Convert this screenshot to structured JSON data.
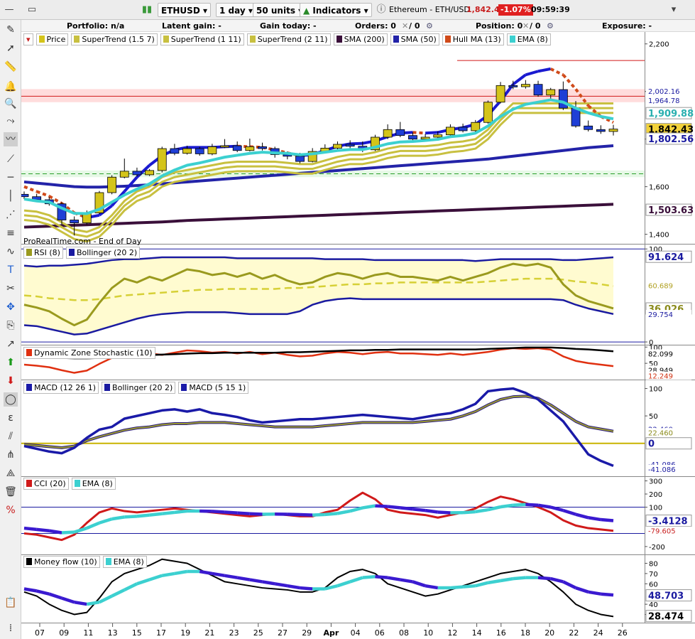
{
  "toolbar": {
    "symbol": "ETHUSD",
    "timeframe": "1 day",
    "units": "50 units",
    "indicators": "Indicators",
    "instrument": "Ethereum - ETH/USD",
    "price": "1,842.43",
    "change": "-1.07%",
    "time": "09:59:39"
  },
  "infobar": {
    "portfolio": "Portfolio: n/a",
    "latent": "Latent gain: -",
    "today": "Gain today: -",
    "orders": "Orders: 0",
    "orders_b": "/ 0",
    "position": "Position: 0",
    "position_b": "/ 0",
    "exposure": "Exposure: -"
  },
  "source_label": "ProRealTime.com - End of Day",
  "colors": {
    "up": "#d4c41a",
    "down": "#1f3fd6",
    "supertrend": "#c8c040",
    "sma200": "#3a0f3a",
    "sma50": "#2323a8",
    "hull_up": "#1a1ad0",
    "hull_dn": "#d04a1a",
    "ema": "#3cd0d0",
    "rsi": "#9a9a1e",
    "boll": "#1a1aa0",
    "cci": "#d01a1a",
    "mfi": "#000000"
  },
  "panels": [
    {
      "id": "price",
      "legend": [
        "Price",
        "SuperTrend (1.5 7)",
        "SuperTrend (1 11)",
        "SuperTrend (2 11)",
        "SMA (200)",
        "SMA (50)",
        "Hull MA (13)",
        "EMA (8)"
      ],
      "ticks": [
        "2,200",
        "2,000",
        "1,800",
        "1,600",
        "1,400"
      ],
      "tags": [
        "2,002.16",
        "1,964.78",
        "1,909.88",
        "1,842.43",
        "1,802.56",
        "1,503.63"
      ]
    },
    {
      "id": "rsi",
      "legend": [
        "RSI (8)",
        "Bollinger (20 2)"
      ],
      "ticks": [
        "100",
        "0"
      ],
      "tags": [
        "91.624",
        "60.689",
        "36.026",
        "29.754"
      ]
    },
    {
      "id": "dzs",
      "legend": [
        "Dynamic Zone Stochastic (10)"
      ],
      "ticks": [
        "100",
        "50"
      ],
      "tags": [
        "82.099",
        "28.949",
        "12.249"
      ]
    },
    {
      "id": "macd",
      "legend": [
        "MACD (12 26 1)",
        "Bollinger (20 2)",
        "MACD (5 15 1)"
      ],
      "ticks": [
        "100",
        "50"
      ],
      "tags": [
        "22.460",
        "22.460",
        "0",
        "-41.086",
        "-41.086"
      ]
    },
    {
      "id": "cci",
      "legend": [
        "CCI (20)",
        "EMA (8)"
      ],
      "ticks": [
        "300",
        "200",
        "100",
        "-200"
      ],
      "tags": [
        "-3.4128",
        "-79.605"
      ]
    },
    {
      "id": "mfi",
      "legend": [
        "Money flow (10)",
        "EMA (8)"
      ],
      "ticks": [
        "80",
        "70",
        "60",
        "40",
        "30"
      ],
      "tags": [
        "48.703",
        "28.474"
      ]
    }
  ],
  "x_axis": [
    "07",
    "09",
    "11",
    "13",
    "15",
    "17",
    "19",
    "21",
    "23",
    "25",
    "27",
    "29",
    "Apr",
    "04",
    "06",
    "08",
    "10",
    "12",
    "14",
    "16",
    "18",
    "20",
    "22",
    "24",
    "26"
  ],
  "chart_data": {
    "type": "candlestick",
    "candles": [
      [
        1568,
        1558,
        1580,
        1548
      ],
      [
        1558,
        1545,
        1570,
        1538
      ],
      [
        1545,
        1528,
        1556,
        1520
      ],
      [
        1528,
        1460,
        1535,
        1440
      ],
      [
        1460,
        1448,
        1475,
        1395
      ],
      [
        1448,
        1490,
        1500,
        1440
      ],
      [
        1490,
        1575,
        1582,
        1485
      ],
      [
        1575,
        1640,
        1648,
        1568
      ],
      [
        1640,
        1665,
        1718,
        1635
      ],
      [
        1665,
        1650,
        1680,
        1642
      ],
      [
        1650,
        1668,
        1674,
        1645
      ],
      [
        1668,
        1760,
        1768,
        1660
      ],
      [
        1760,
        1740,
        1780,
        1732
      ],
      [
        1740,
        1760,
        1772,
        1735
      ],
      [
        1760,
        1738,
        1768,
        1730
      ],
      [
        1738,
        1768,
        1780,
        1732
      ],
      [
        1768,
        1772,
        1800,
        1762
      ],
      [
        1772,
        1752,
        1790,
        1745
      ],
      [
        1752,
        1768,
        1802,
        1748
      ],
      [
        1768,
        1760,
        1785,
        1752
      ],
      [
        1760,
        1735,
        1768,
        1722
      ],
      [
        1735,
        1728,
        1748,
        1715
      ],
      [
        1728,
        1706,
        1742,
        1698
      ],
      [
        1706,
        1748,
        1762,
        1702
      ],
      [
        1748,
        1762,
        1778,
        1740
      ],
      [
        1762,
        1778,
        1790,
        1755
      ],
      [
        1778,
        1770,
        1795,
        1762
      ],
      [
        1770,
        1755,
        1790,
        1745
      ],
      [
        1755,
        1808,
        1818,
        1750
      ],
      [
        1808,
        1840,
        1862,
        1800
      ],
      [
        1840,
        1815,
        1872,
        1808
      ],
      [
        1815,
        1800,
        1828,
        1792
      ],
      [
        1800,
        1808,
        1822,
        1795
      ],
      [
        1808,
        1818,
        1832,
        1800
      ],
      [
        1818,
        1850,
        1862,
        1810
      ],
      [
        1850,
        1835,
        1865,
        1828
      ],
      [
        1835,
        1870,
        1880,
        1830
      ],
      [
        1870,
        1955,
        1962,
        1865
      ],
      [
        1955,
        2025,
        2040,
        1950
      ],
      [
        2025,
        2020,
        2045,
        2010
      ],
      [
        2020,
        2030,
        2048,
        2012
      ],
      [
        2030,
        1985,
        2045,
        1978
      ],
      [
        1985,
        2008,
        2015,
        1960
      ],
      [
        2008,
        1930,
        2042,
        1922
      ],
      [
        1930,
        1855,
        1960,
        1848
      ],
      [
        1855,
        1840,
        1878,
        1832
      ],
      [
        1840,
        1832,
        1858,
        1822
      ],
      [
        1832,
        1842,
        1860,
        1815
      ]
    ],
    "ema8": [
      1548,
      1540,
      1535,
      1510,
      1488,
      1487,
      1505,
      1535,
      1565,
      1590,
      1612,
      1645,
      1670,
      1690,
      1700,
      1712,
      1724,
      1732,
      1740,
      1745,
      1742,
      1740,
      1734,
      1738,
      1745,
      1752,
      1756,
      1756,
      1766,
      1780,
      1788,
      1790,
      1794,
      1799,
      1810,
      1815,
      1825,
      1855,
      1895,
      1925,
      1946,
      1955,
      1965,
      1955,
      1930,
      1910,
      1895,
      1885
    ],
    "sma50": [
      1620,
      1615,
      1610,
      1605,
      1600,
      1598,
      1598,
      1600,
      1602,
      1605,
      1608,
      1612,
      1616,
      1620,
      1624,
      1628,
      1632,
      1636,
      1640,
      1644,
      1648,
      1652,
      1656,
      1660,
      1664,
      1668,
      1672,
      1676,
      1680,
      1684,
      1688,
      1692,
      1696,
      1700,
      1704,
      1708,
      1712,
      1716,
      1722,
      1728,
      1734,
      1740,
      1746,
      1752,
      1758,
      1764,
      1768,
      1772
    ],
    "sma200": [
      1430,
      1432,
      1434,
      1436,
      1438,
      1440,
      1442,
      1444,
      1446,
      1448,
      1450,
      1452,
      1455,
      1458,
      1460,
      1462,
      1464,
      1466,
      1468,
      1470,
      1472,
      1474,
      1476,
      1478,
      1480,
      1482,
      1484,
      1486,
      1488,
      1490,
      1492,
      1494,
      1496,
      1498,
      1500,
      1502,
      1504,
      1506,
      1508,
      1510,
      1512,
      1514,
      1516,
      1518,
      1520,
      1522,
      1524,
      1526
    ],
    "hull": [
      1600,
      1580,
      1560,
      1530,
      1490,
      1470,
      1480,
      1520,
      1580,
      1640,
      1690,
      1730,
      1755,
      1765,
      1765,
      1765,
      1768,
      1770,
      1768,
      1765,
      1755,
      1742,
      1730,
      1735,
      1752,
      1770,
      1780,
      1782,
      1792,
      1810,
      1825,
      1828,
      1825,
      1828,
      1840,
      1848,
      1862,
      1900,
      1960,
      2030,
      2070,
      2085,
      2095,
      2070,
      2010,
      1940,
      1895,
      1870
    ],
    "st1": [
      1500,
      1495,
      1480,
      1450,
      1420,
      1410,
      1430,
      1480,
      1540,
      1580,
      1600,
      1640,
      1660,
      1670,
      1680,
      1690,
      1700,
      1705,
      1705,
      1705,
      1705,
      1700,
      1695,
      1695,
      1710,
      1725,
      1735,
      1735,
      1745,
      1760,
      1770,
      1770,
      1770,
      1775,
      1785,
      1790,
      1800,
      1840,
      1900,
      1950,
      1950,
      1950,
      1950,
      1950,
      1950,
      1950,
      1950,
      1950
    ],
    "st2": [
      1480,
      1475,
      1460,
      1430,
      1400,
      1390,
      1410,
      1460,
      1520,
      1560,
      1580,
      1620,
      1640,
      1650,
      1660,
      1670,
      1680,
      1685,
      1685,
      1685,
      1685,
      1680,
      1675,
      1675,
      1690,
      1705,
      1715,
      1715,
      1725,
      1740,
      1750,
      1750,
      1750,
      1755,
      1765,
      1770,
      1780,
      1820,
      1880,
      1930,
      1930,
      1930,
      1930,
      1930,
      1930,
      1930,
      1930,
      1930
    ],
    "st3": [
      1460,
      1455,
      1440,
      1410,
      1380,
      1370,
      1390,
      1440,
      1500,
      1540,
      1560,
      1600,
      1620,
      1630,
      1640,
      1650,
      1660,
      1665,
      1665,
      1665,
      1665,
      1660,
      1655,
      1655,
      1670,
      1685,
      1695,
      1695,
      1705,
      1720,
      1730,
      1730,
      1730,
      1735,
      1745,
      1750,
      1760,
      1800,
      1860,
      1910,
      1910,
      1910,
      1910,
      1910,
      1910,
      1910,
      1910,
      1910
    ],
    "rsi": [
      40,
      37,
      33,
      25,
      18,
      24,
      42,
      58,
      68,
      64,
      70,
      66,
      72,
      78,
      76,
      72,
      74,
      70,
      74,
      68,
      72,
      66,
      62,
      64,
      70,
      74,
      72,
      68,
      72,
      74,
      70,
      70,
      68,
      66,
      70,
      66,
      70,
      74,
      80,
      84,
      82,
      84,
      80,
      62,
      50,
      44,
      40,
      36
    ],
    "boll_up": [
      82,
      81,
      82,
      82,
      83,
      84,
      86,
      88,
      89,
      89,
      90,
      91,
      91,
      91,
      91,
      91,
      91,
      90,
      90,
      90,
      90,
      90,
      90,
      90,
      89,
      89,
      89,
      89,
      88,
      88,
      88,
      88,
      88,
      88,
      88,
      88,
      87,
      88,
      89,
      89,
      89,
      89,
      89,
      88,
      88,
      89,
      90,
      91
    ],
    "boll_mid": [
      50,
      49,
      47,
      46,
      45,
      45,
      46,
      48,
      50,
      51,
      52,
      53,
      54,
      55,
      56,
      56,
      57,
      57,
      57,
      57,
      57,
      58,
      58,
      59,
      60,
      61,
      62,
      62,
      63,
      63,
      64,
      64,
      64,
      64,
      64,
      64,
      64,
      65,
      66,
      67,
      68,
      68,
      68,
      67,
      65,
      64,
      62,
      60
    ],
    "boll_dn": [
      18,
      17,
      14,
      11,
      8,
      9,
      13,
      17,
      21,
      25,
      28,
      30,
      31,
      32,
      32,
      32,
      32,
      31,
      30,
      30,
      30,
      30,
      33,
      40,
      44,
      46,
      47,
      46,
      46,
      46,
      46,
      46,
      46,
      46,
      46,
      46,
      46,
      46,
      46,
      46,
      46,
      46,
      46,
      45,
      40,
      36,
      33,
      30
    ],
    "macd_fast": [
      -5,
      -10,
      -15,
      -18,
      -8,
      10,
      25,
      30,
      45,
      50,
      55,
      60,
      62,
      58,
      62,
      55,
      52,
      48,
      42,
      38,
      40,
      42,
      44,
      44,
      46,
      48,
      50,
      52,
      50,
      48,
      46,
      44,
      48,
      52,
      55,
      62,
      72,
      95,
      98,
      100,
      92,
      80,
      60,
      40,
      10,
      -20,
      -32,
      -41
    ],
    "macd_slow": [
      -2,
      -4,
      -6,
      -8,
      -5,
      5,
      12,
      18,
      24,
      28,
      30,
      34,
      36,
      36,
      38,
      38,
      38,
      36,
      34,
      32,
      30,
      30,
      30,
      30,
      32,
      34,
      36,
      38,
      38,
      38,
      38,
      38,
      40,
      42,
      44,
      50,
      58,
      70,
      80,
      85,
      86,
      82,
      70,
      55,
      40,
      30,
      26,
      22
    ],
    "cci": [
      -100,
      -110,
      -130,
      -150,
      -110,
      -20,
      60,
      90,
      70,
      60,
      70,
      80,
      90,
      80,
      70,
      60,
      50,
      40,
      30,
      40,
      50,
      40,
      30,
      30,
      60,
      80,
      150,
      210,
      160,
      80,
      60,
      50,
      40,
      20,
      40,
      60,
      90,
      140,
      180,
      160,
      130,
      100,
      60,
      0,
      -40,
      -60,
      -70,
      -80
    ],
    "cci_ema": [
      -60,
      -70,
      -80,
      -95,
      -90,
      -60,
      -20,
      10,
      25,
      30,
      40,
      50,
      60,
      70,
      70,
      68,
      62,
      56,
      50,
      46,
      47,
      46,
      43,
      40,
      44,
      52,
      70,
      95,
      110,
      105,
      95,
      85,
      75,
      62,
      57,
      58,
      65,
      80,
      102,
      115,
      120,
      115,
      100,
      75,
      45,
      20,
      5,
      -3
    ],
    "mfi": [
      52,
      48,
      40,
      34,
      30,
      32,
      46,
      62,
      70,
      74,
      78,
      84,
      82,
      80,
      74,
      68,
      62,
      60,
      58,
      56,
      55,
      54,
      52,
      52,
      56,
      66,
      72,
      74,
      70,
      60,
      56,
      52,
      48,
      50,
      54,
      58,
      62,
      66,
      70,
      72,
      74,
      70,
      62,
      52,
      40,
      34,
      30,
      28
    ],
    "mfi_ema": [
      55,
      53,
      50,
      46,
      42,
      40,
      42,
      48,
      54,
      60,
      64,
      68,
      70,
      72,
      72,
      70,
      68,
      66,
      64,
      62,
      60,
      58,
      56,
      55,
      55,
      58,
      62,
      66,
      67,
      66,
      64,
      62,
      58,
      56,
      56,
      57,
      58,
      61,
      63,
      65,
      66,
      66,
      65,
      62,
      56,
      52,
      50,
      49
    ]
  }
}
